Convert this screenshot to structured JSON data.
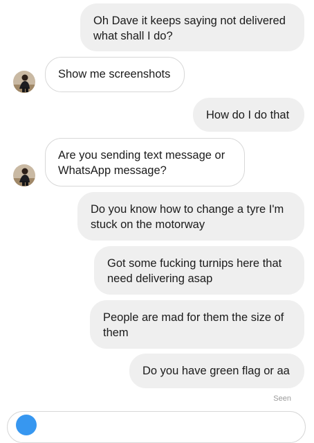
{
  "messages": [
    {
      "direction": "out",
      "text": "Oh Dave it keeps saying not delivered what shall I do?"
    },
    {
      "direction": "in",
      "text": "Show me screenshots"
    },
    {
      "direction": "out",
      "text": "How do I do that"
    },
    {
      "direction": "in",
      "text": "Are you sending text message or WhatsApp message?"
    },
    {
      "direction": "out",
      "text": "Do you know how to change a tyre I'm stuck on the motorway"
    },
    {
      "direction": "out",
      "text": "Got some fucking turnips here that need delivering asap"
    },
    {
      "direction": "out",
      "text": "People are mad for them the size of them"
    },
    {
      "direction": "out",
      "text": "Do you have green flag or aa"
    }
  ],
  "status": {
    "seen_label": "Seen"
  },
  "colors": {
    "outgoing_bubble": "#efefef",
    "incoming_border": "#d7d7d7",
    "accent": "#3797f0"
  }
}
